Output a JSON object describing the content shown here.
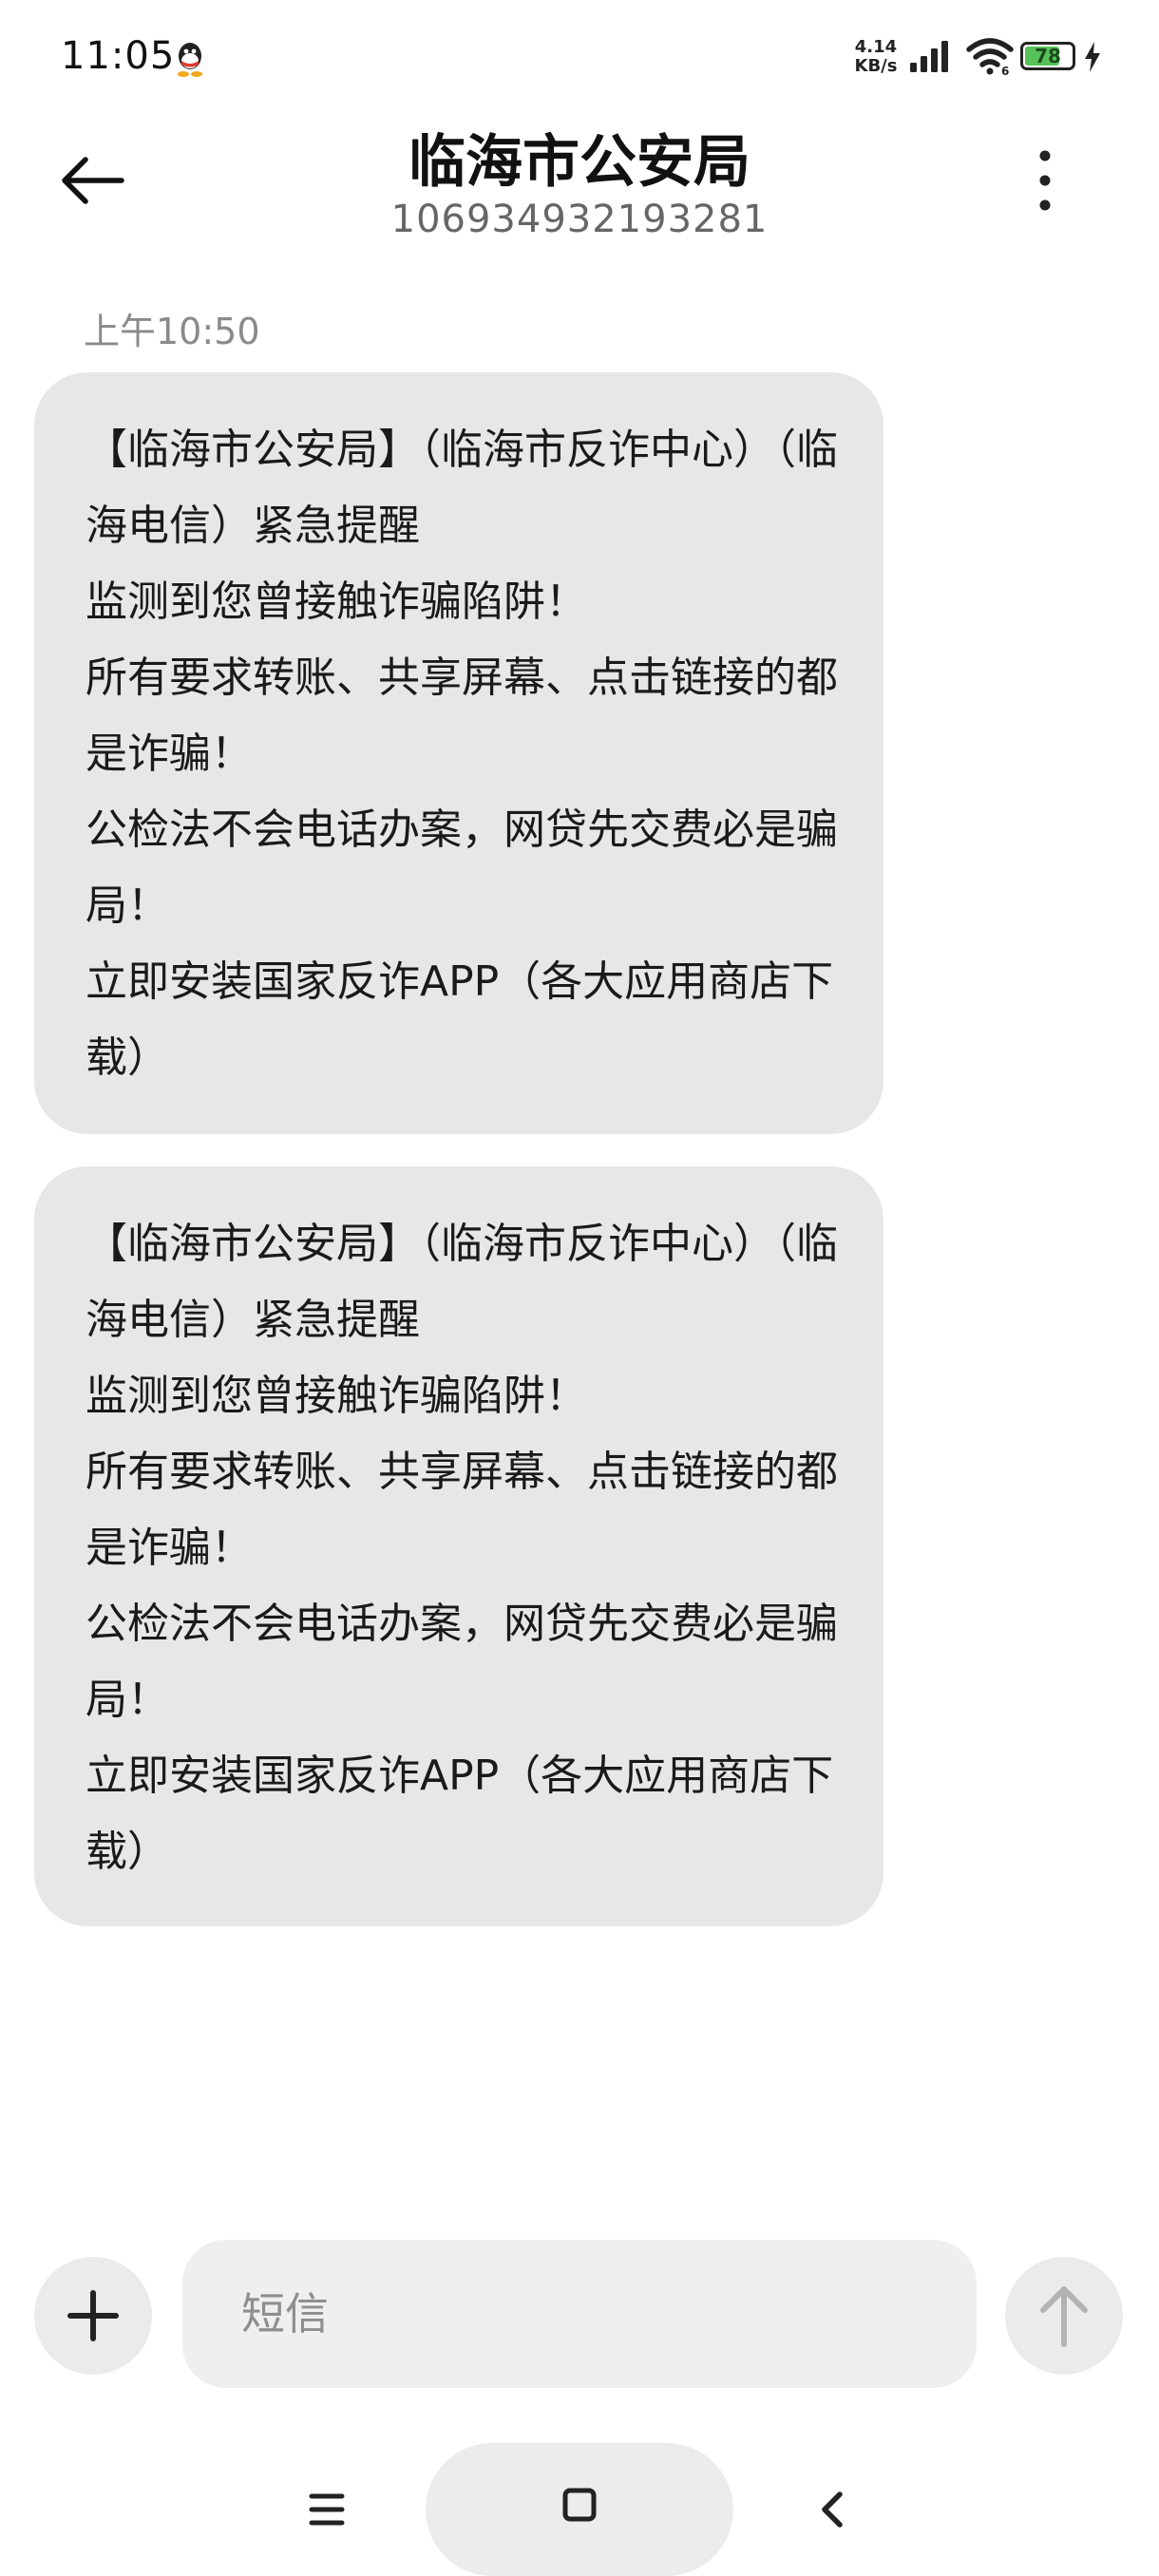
{
  "status_bar": {
    "time": "11:05",
    "net_speed_value": "4.14",
    "net_speed_unit": "KB/s",
    "battery_level": "78",
    "battery_percent": 78,
    "icons": [
      "qq-icon",
      "signal-icon",
      "wifi-icon",
      "battery-icon",
      "charging-icon"
    ]
  },
  "header": {
    "title": "临海市公安局",
    "subtitle": "106934932193281",
    "back_icon": "arrow-left-icon",
    "menu_icon": "more-vertical-icon"
  },
  "conversation": {
    "time_label": "上午10:50",
    "messages": [
      {
        "text": "【临海市公安局】（临海市反诈中心）（临海电信）紧急提醒\n监测到您曾接触诈骗陷阱！\n所有要求转账、共享屏幕、点击链接的都是诈骗！\n公检法不会电话办案，网贷先交费必是骗局！\n立即安装国家反诈APP（各大应用商店下载）"
      },
      {
        "text": "【临海市公安局】（临海市反诈中心）（临海电信）紧急提醒\n监测到您曾接触诈骗陷阱！\n所有要求转账、共享屏幕、点击链接的都是诈骗！\n公检法不会电话办案，网贷先交费必是骗局！\n立即安装国家反诈APP（各大应用商店下载）"
      }
    ]
  },
  "composer": {
    "placeholder": "短信",
    "value": "",
    "add_icon": "plus-icon",
    "send_icon": "arrow-up-icon"
  },
  "nav_bar": {
    "icons": [
      "menu-icon",
      "home-icon",
      "back-icon"
    ]
  },
  "colors": {
    "bubble": "#e7e7e7",
    "input": "#efefef",
    "battery_fill": "#58c25a",
    "secondary_text": "#8a8a8a"
  }
}
